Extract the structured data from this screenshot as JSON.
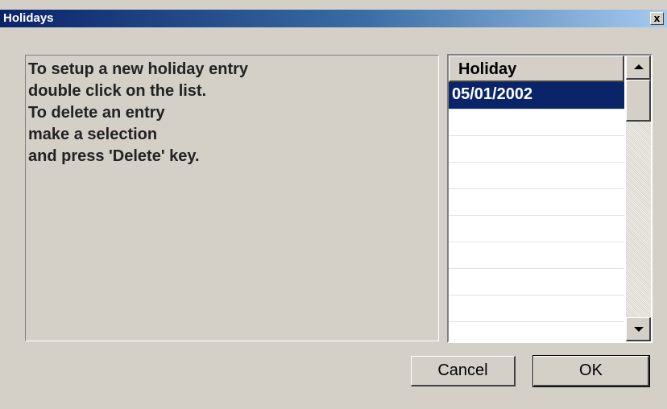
{
  "window": {
    "title": "Holidays",
    "close_label": "x"
  },
  "instructions": {
    "lines": [
      "To setup a new holiday entry",
      "double click on the list.",
      "To delete an entry",
      "make a selection",
      "and press 'Delete' key."
    ]
  },
  "holiday_list": {
    "column_header": "Holiday",
    "rows": [
      "05/01/2002",
      "",
      "",
      "",
      "",
      "",
      "",
      "",
      "",
      ""
    ],
    "selected_index": 0
  },
  "buttons": {
    "cancel_label": "Cancel",
    "ok_label": "OK"
  },
  "colors": {
    "title_bar_start": "#0a246a",
    "title_bar_end": "#a6caf0",
    "selection": "#0a246a",
    "dialog_face": "#d4d0c8"
  }
}
